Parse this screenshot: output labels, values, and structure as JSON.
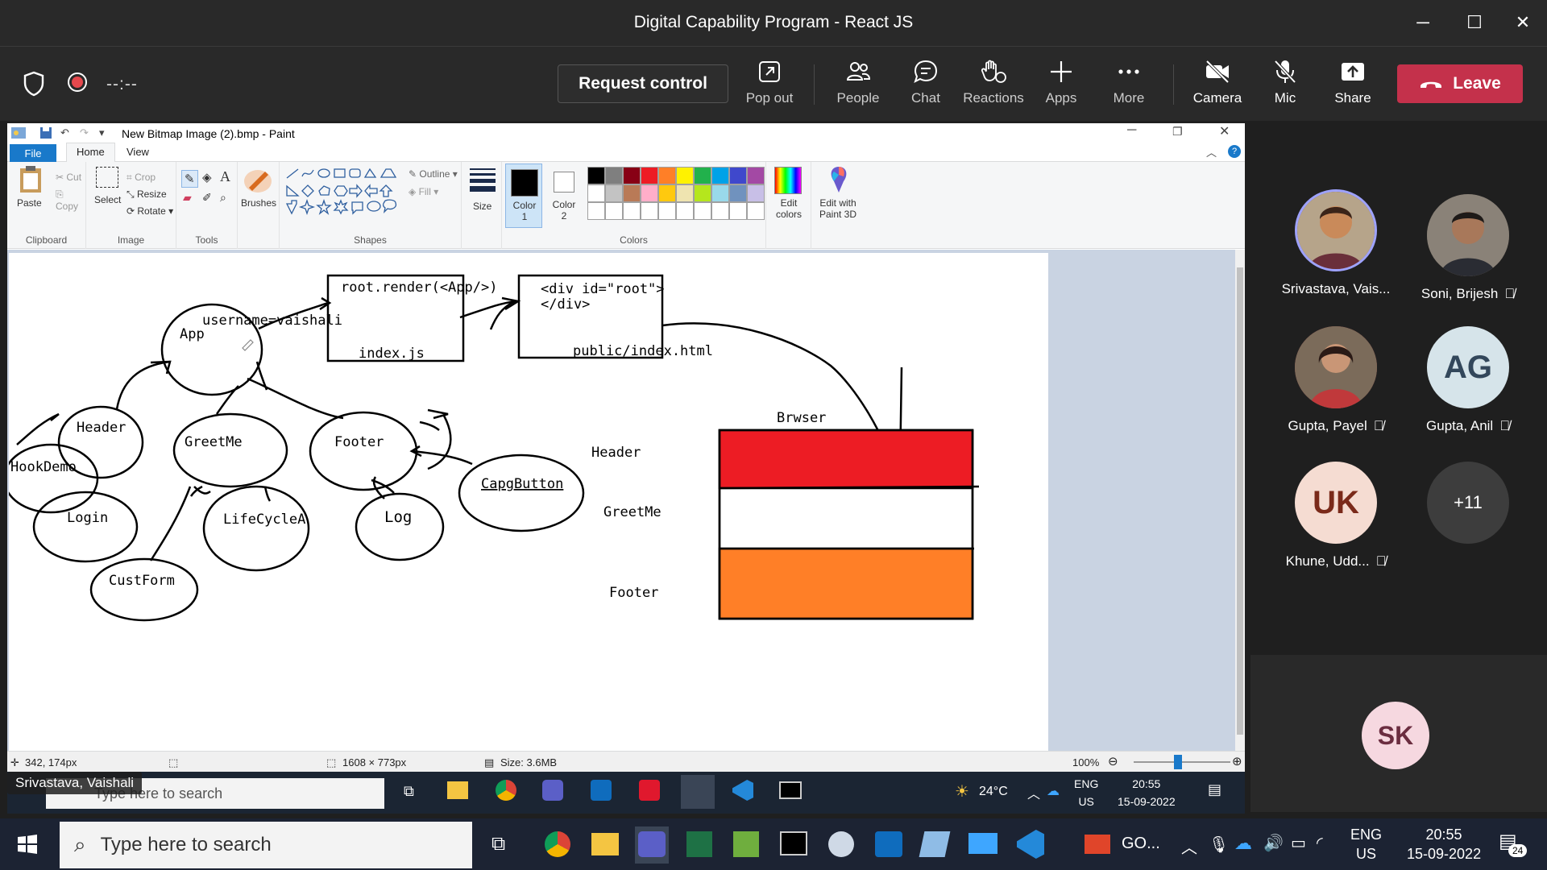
{
  "window": {
    "title": "Digital Capability Program - React JS",
    "minimize": "─",
    "maximize": "☐",
    "close": "✕"
  },
  "meeting_bar": {
    "timer": "--:--",
    "request_control": "Request control",
    "buttons": [
      {
        "label": "Pop out",
        "icon": "pop-out-icon"
      },
      {
        "label": "People",
        "icon": "people-icon"
      },
      {
        "label": "Chat",
        "icon": "chat-icon"
      },
      {
        "label": "Reactions",
        "icon": "reactions-icon"
      },
      {
        "label": "Apps",
        "icon": "apps-icon"
      },
      {
        "label": "More",
        "icon": "more-icon"
      },
      {
        "label": "Camera",
        "icon": "camera-off-icon"
      },
      {
        "label": "Mic",
        "icon": "mic-off-icon"
      },
      {
        "label": "Share",
        "icon": "share-icon"
      }
    ],
    "leave": "Leave",
    "leave_color": "#c4314b"
  },
  "paint": {
    "doc_title": "New Bitmap Image (2).bmp - Paint",
    "tabs": {
      "file": "File",
      "home": "Home",
      "view": "View"
    },
    "ribbon": {
      "clipboard": {
        "label": "Clipboard",
        "paste": "Paste",
        "cut": "Cut",
        "copy": "Copy"
      },
      "image": {
        "label": "Image",
        "select": "Select",
        "crop": "Crop",
        "resize": "Resize",
        "rotate": "Rotate"
      },
      "tools": {
        "label": "Tools"
      },
      "brushes": "Brushes",
      "shapes": {
        "label": "Shapes",
        "outline": "Outline",
        "fill": "Fill"
      },
      "size": "Size",
      "color1": "Color 1",
      "color2": "Color 2",
      "colors_label": "Colors",
      "edit_colors": "Edit colors",
      "paint3d": "Edit with Paint 3D",
      "palette_row1": [
        "#000000",
        "#7f7f7f",
        "#880015",
        "#ed1c24",
        "#ff7f27",
        "#fff200",
        "#22b14c",
        "#00a2e8",
        "#3f48cc",
        "#a349a4"
      ],
      "palette_row2": [
        "#ffffff",
        "#c3c3c3",
        "#b97a57",
        "#ffaec9",
        "#ffc90e",
        "#efe4b0",
        "#b5e61d",
        "#99d9ea",
        "#7092be",
        "#c8bfe7"
      ]
    },
    "status": {
      "cursor": "342, 174px",
      "dimensions": "1608 × 773px",
      "size": "Size: 3.6MB",
      "zoom": "100%"
    },
    "canvas": {
      "render_box": "root.render(<App/>)",
      "index_js": "index.js",
      "div_root_1": "<div id=\"root\">",
      "div_root_2": "</div>",
      "public_index": "public/index.html",
      "username": "username=vaishali",
      "app": "App",
      "header": "Header",
      "greetme": "GreetMe",
      "footer": "Footer",
      "hookdemo": "HookDemo",
      "login": "Login",
      "lifecycle": "LifeCycleA",
      "log": "Log",
      "capgbutton": "CapgButton",
      "custform": "CustForm",
      "browser": "Brwser",
      "lbl_header": "Header",
      "lbl_greetme": "GreetMe",
      "lbl_footer": "Footer",
      "band_colors": [
        "#ed1c24",
        "#ffffff",
        "#ff7f27"
      ]
    }
  },
  "inner_taskbar": {
    "presenter": "Srivastava, Vaishali",
    "search_placeholder": "Type here to search",
    "weather": "24°C",
    "lang": "ENG",
    "region": "US",
    "time": "20:55",
    "date": "15-09-2022"
  },
  "participants": [
    {
      "name": "Srivastava, Vais...",
      "initials": "",
      "muted": false,
      "speaking": true,
      "color": "#c98a5a"
    },
    {
      "name": "Soni, Brijesh",
      "initials": "",
      "muted": true,
      "color": "#5a5048"
    },
    {
      "name": "Gupta, Payel",
      "initials": "",
      "muted": true,
      "color": "#b04a4a"
    },
    {
      "name": "Gupta, Anil",
      "initials": "AG",
      "muted": true,
      "color": "#d6e4ea",
      "text_color": "#33475b"
    },
    {
      "name": "Khune, Udd...",
      "initials": "UK",
      "muted": true,
      "color": "#f5dcd2",
      "text_color": "#7a2a1a"
    },
    {
      "name": "",
      "initials": "+11",
      "muted": false,
      "color": "#3d3d3d",
      "text_color": "#ffffff"
    }
  ],
  "self_tile": {
    "initials": "SK"
  },
  "host_taskbar": {
    "search_placeholder": "Type here to search",
    "pinned_app_label": "GO...",
    "lang": "ENG",
    "region": "US",
    "time": "20:55",
    "date": "15-09-2022",
    "notifications": "24"
  }
}
